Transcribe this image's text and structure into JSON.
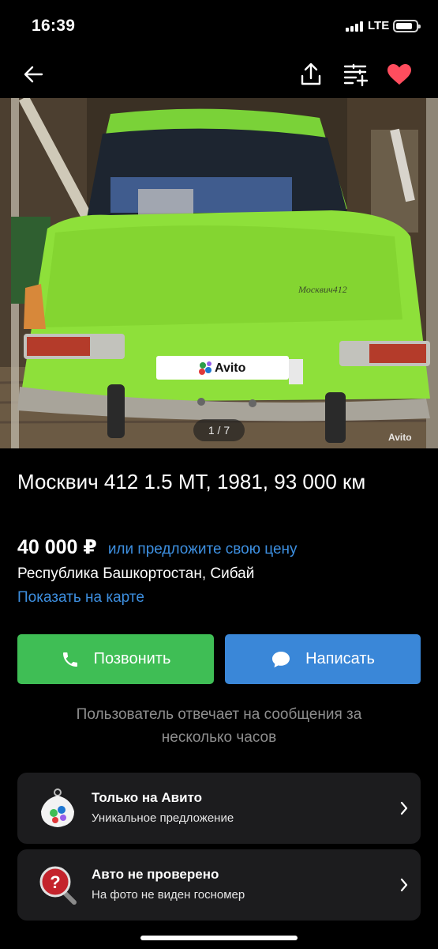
{
  "status_bar": {
    "time": "16:39",
    "network": "LTE",
    "icons": [
      "signal-icon",
      "battery-icon"
    ]
  },
  "toolbar": {
    "icons": [
      "back-arrow-icon",
      "share-icon",
      "compare-list-icon",
      "heart-icon"
    ],
    "accent_color": "#ff4d5e"
  },
  "gallery": {
    "counter": "1 / 7",
    "watermark": "Avito",
    "plate_text": "Avito",
    "badge_text": "Москвич412"
  },
  "listing": {
    "title": "Москвич 412 1.5 MT, 1981, 93 000 км",
    "price": "40 000 ₽",
    "offer_link": "или предложите свою цену",
    "location": "Республика Башкортостан, Сибай",
    "map_link": "Показать на карте"
  },
  "actions": {
    "call_label": "Позвонить",
    "message_label": "Написать",
    "call_color": "#3fbe55",
    "message_color": "#3a87d8"
  },
  "reply_note": "Пользователь отвечает на сообщения за несколько часов",
  "cards": [
    {
      "title": "Только на Авито",
      "subtitle": "Уникальное предложение",
      "icon": "avito-tag-icon"
    },
    {
      "title": "Авто не проверено",
      "subtitle": "На фото не виден госномер",
      "icon": "question-magnifier-icon"
    }
  ]
}
